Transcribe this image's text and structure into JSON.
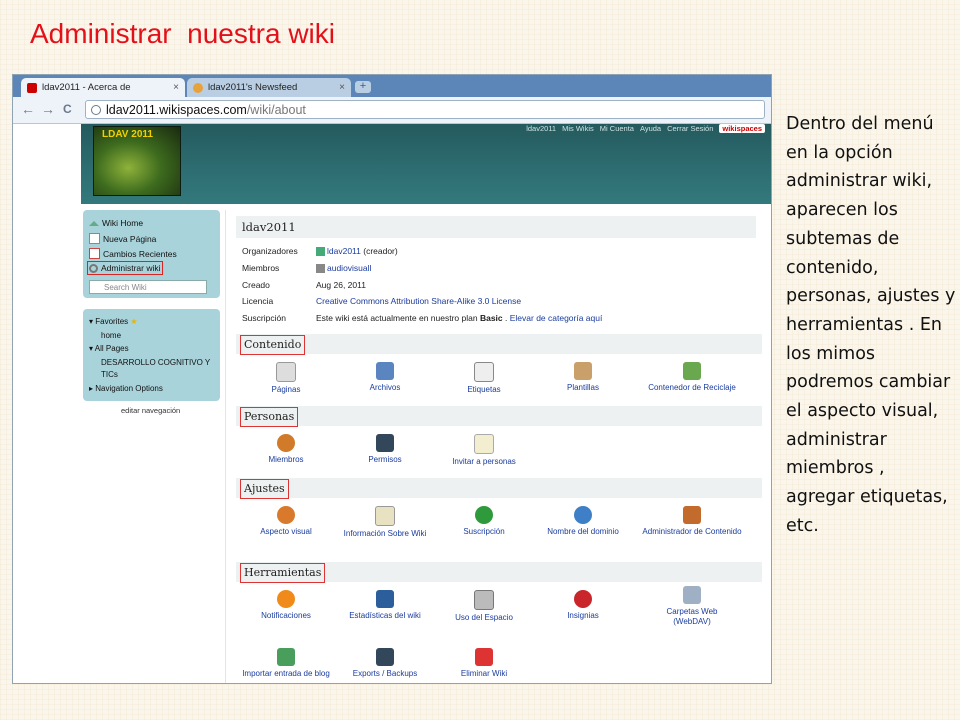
{
  "slide": {
    "title": "Administrar  nuestra wiki",
    "description": "Dentro del menú en la opción administrar wiki, aparecen los subtemas de contenido, personas, ajustes y herramientas . En los mimos podremos cambiar el aspecto visual, administrar miembros , agregar etiquetas, etc."
  },
  "browser": {
    "tabs": [
      {
        "label": "ldav2011 - Acerca de",
        "close": "×"
      },
      {
        "label": "ldav2011's Newsfeed",
        "close": "×"
      }
    ],
    "new_tab": "+",
    "url_domain": "ldav2011.wikispaces.com",
    "url_path": "/wiki/about",
    "back": "←",
    "forward": "→",
    "reload": "C"
  },
  "header": {
    "logo_text": "LDAV 2011",
    "links": [
      "ldav2011",
      "Mis Wikis",
      "Mi Cuenta",
      "Ayuda",
      "Cerrar Sesión"
    ],
    "brand": "wikispaces"
  },
  "sidebar": {
    "items": [
      "Wiki Home",
      "Nueva Página",
      "Cambios Recientes",
      "Administrar wiki"
    ],
    "search_placeholder": "Search Wiki",
    "nav": [
      "Favorites",
      "home",
      "All Pages",
      "DESARROLLO COGNITIVO Y TICs",
      "Navigation Options"
    ],
    "edit_nav": "editar navegación"
  },
  "main": {
    "title": "ldav2011",
    "info": [
      {
        "label": "Organizadores",
        "value": "ldav2011",
        "suffix": " (creador)"
      },
      {
        "label": "Miembros",
        "value": "audiovisuall",
        "suffix": ""
      },
      {
        "label": "Creado",
        "value": "Aug 26, 2011",
        "suffix": ""
      },
      {
        "label": "Licencia",
        "value": "Creative Commons Attribution Share-Alike 3.0 License",
        "suffix": ""
      },
      {
        "label": "Suscripción",
        "value": "Este wiki está actualmente en nuestro plan ",
        "bold": "Basic",
        "after": " . ",
        "link": "Elevar de categoría aquí"
      }
    ],
    "sections": [
      {
        "label": "Contenido",
        "tools": [
          "Páginas",
          "Archivos",
          "Etiquetas",
          "Plantillas",
          "Contenedor de Reciclaje"
        ]
      },
      {
        "label": "Personas",
        "tools": [
          "Miembros",
          "Permisos",
          "Invitar a personas"
        ]
      },
      {
        "label": "Ajustes",
        "tools": [
          "Aspecto visual",
          "Información Sobre Wiki",
          "Suscripción",
          "Nombre del dominio",
          "Administrador de Contenido"
        ]
      },
      {
        "label": "Herramientas",
        "tools": [
          "Notificaciones",
          "Estadísticas del wiki",
          "Uso del Espacio",
          "Insignias",
          "Carpetas Web (WebDAV)",
          "Importar entrada de blog",
          "Exports / Backups",
          "Eliminar Wiki"
        ]
      }
    ]
  },
  "colors": {
    "title": "#e3101a",
    "header": "#2e6e72",
    "sidebar": "#a9d3da",
    "link": "#1a3c9e"
  }
}
